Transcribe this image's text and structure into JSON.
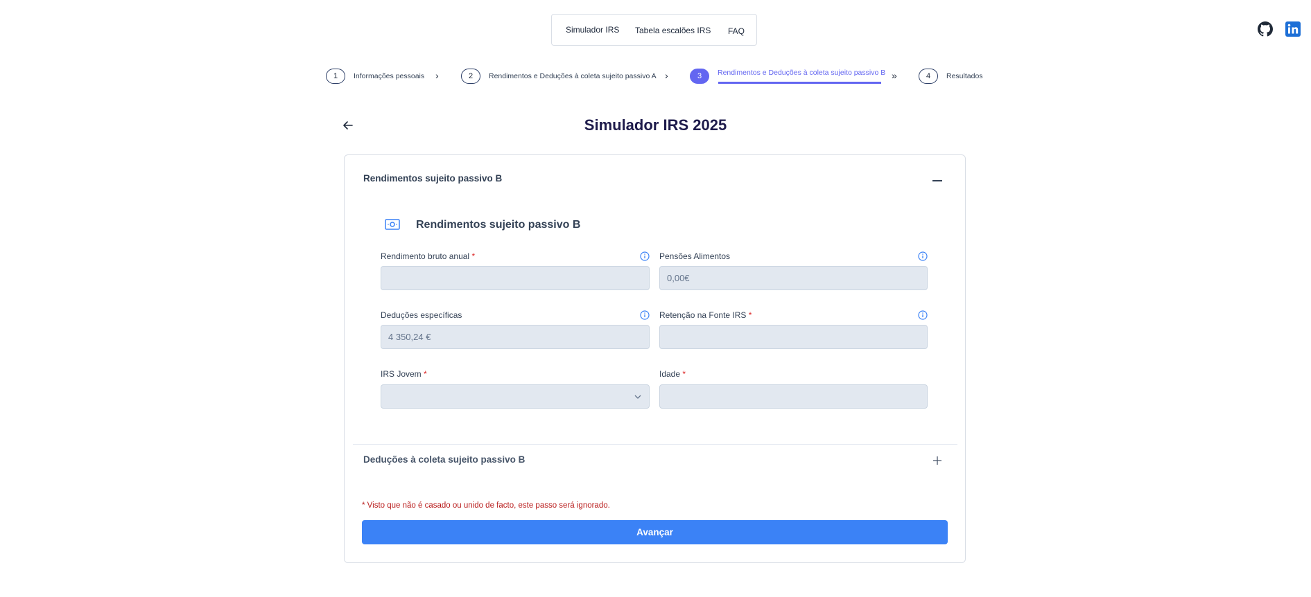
{
  "nav": {
    "items": [
      "Simulador IRS",
      "Tabela escalões IRS",
      "FAQ"
    ]
  },
  "social": {
    "github": "github-icon",
    "linkedin": "linkedin-icon"
  },
  "stepper": {
    "steps": [
      {
        "num": "1",
        "label": "Informações pessoais"
      },
      {
        "num": "2",
        "label": "Rendimentos e Deduções à coleta sujeito passivo A"
      },
      {
        "num": "3",
        "label": "Rendimentos e Deduções à coleta sujeito passivo B"
      },
      {
        "num": "4",
        "label": "Resultados"
      }
    ],
    "active_index": 2,
    "accent": "#6366f1"
  },
  "page": {
    "title": "Simulador IRS 2025"
  },
  "accordion": {
    "income_header": "Rendimentos sujeito passivo B",
    "deductions_header": "Deduções à coleta sujeito passivo B"
  },
  "section": {
    "title": "Rendimentos sujeito passivo B",
    "icon": "money-icon"
  },
  "fields": {
    "gross_income": {
      "label": "Rendimento bruto anual",
      "required": "*",
      "value": ""
    },
    "alimony": {
      "label": "Pensões Alimentos",
      "value": "0,00€"
    },
    "specific_deductions": {
      "label": "Deduções específicas",
      "value": "4 350,24 €"
    },
    "withholding": {
      "label": "Retenção na Fonte IRS",
      "required": "*",
      "value": ""
    },
    "irs_jovem": {
      "label": "IRS Jovem",
      "required": "*",
      "value": ""
    },
    "age": {
      "label": "Idade",
      "required": "*",
      "value": ""
    }
  },
  "note": "* Visto que não é casado ou unido de facto, este passo será ignorado.",
  "actions": {
    "next_label": "Avançar",
    "button_color": "#3b82f6"
  }
}
